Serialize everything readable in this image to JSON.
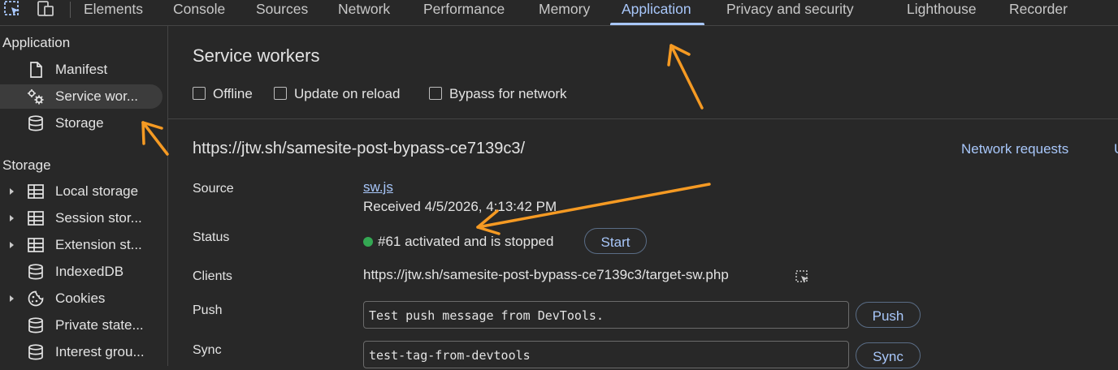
{
  "toolbar": {
    "tabs": [
      "Elements",
      "Console",
      "Sources",
      "Network",
      "Performance",
      "Memory",
      "Application",
      "Privacy and security",
      "Lighthouse",
      "Recorder"
    ],
    "active_tab": "Application",
    "icons": [
      "inspect-element-icon",
      "device-toolbar-icon"
    ]
  },
  "sidebar": {
    "application_heading": "Application",
    "application_items": [
      {
        "label": "Manifest",
        "icon": "file-icon"
      },
      {
        "label": "Service wor...",
        "icon": "service-worker-gear-icon"
      },
      {
        "label": "Storage",
        "icon": "database-icon"
      }
    ],
    "storage_heading": "Storage",
    "storage_items": [
      {
        "label": "Local storage",
        "icon": "table-icon",
        "expandable": true
      },
      {
        "label": "Session stor...",
        "icon": "table-icon",
        "expandable": true
      },
      {
        "label": "Extension st...",
        "icon": "table-icon",
        "expandable": true
      },
      {
        "label": "IndexedDB",
        "icon": "database-icon",
        "expandable": false
      },
      {
        "label": "Cookies",
        "icon": "cookie-icon",
        "expandable": true
      },
      {
        "label": "Private state...",
        "icon": "database-icon",
        "expandable": false
      },
      {
        "label": "Interest grou...",
        "icon": "database-icon",
        "expandable": false
      }
    ]
  },
  "main": {
    "title": "Service workers",
    "options": [
      {
        "label": "Offline",
        "checked": false
      },
      {
        "label": "Update on reload",
        "checked": false
      },
      {
        "label": "Bypass for network",
        "checked": false
      }
    ],
    "worker": {
      "url": "https://jtw.sh/samesite-post-bypass-ce7139c3/",
      "network_requests": "Network requests",
      "next_link_fragment": "U",
      "source_label": "Source",
      "source_link": "sw.js",
      "received": "Received 4/5/2026, 4:13:42 PM",
      "status_label": "Status",
      "status_text": "#61 activated and is stopped",
      "status_color": "#34a853",
      "start_button": "Start",
      "clients_label": "Clients",
      "client_url": "https://jtw.sh/samesite-post-bypass-ce7139c3/target-sw.php",
      "push_label": "Push",
      "push_value": "Test push message from DevTools.",
      "push_button": "Push",
      "sync_label": "Sync",
      "sync_value": "test-tag-from-devtools",
      "sync_button": "Sync"
    }
  },
  "annotation_color": "#f59a23"
}
